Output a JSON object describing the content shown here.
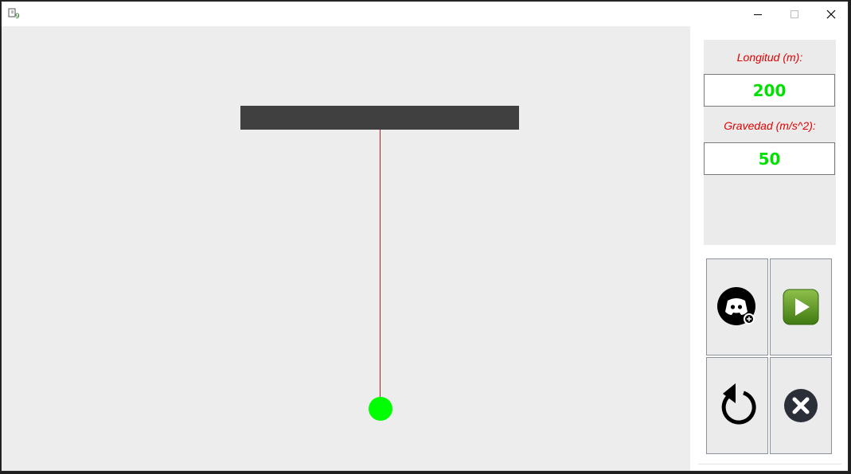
{
  "window": {
    "app_icon": "java-app-icon",
    "controls": [
      "minimize-icon",
      "maximize-icon",
      "close-icon"
    ]
  },
  "simulation": {
    "beam_color": "#404040",
    "string_color": "#cc1a1a",
    "bob_color": "#00ff00",
    "background": "#ededed"
  },
  "params": {
    "length_label": "Longitud (m):",
    "length_value": "200",
    "gravity_label": "Gravedad (m/s^2):",
    "gravity_value": "50",
    "label_color": "#e00000",
    "value_color": "#00e000"
  },
  "buttons": [
    {
      "name": "discord-button",
      "icon": "discord-icon"
    },
    {
      "name": "play-button",
      "icon": "play-icon"
    },
    {
      "name": "reset-button",
      "icon": "reset-icon"
    },
    {
      "name": "exit-button",
      "icon": "close-circle-icon"
    }
  ]
}
